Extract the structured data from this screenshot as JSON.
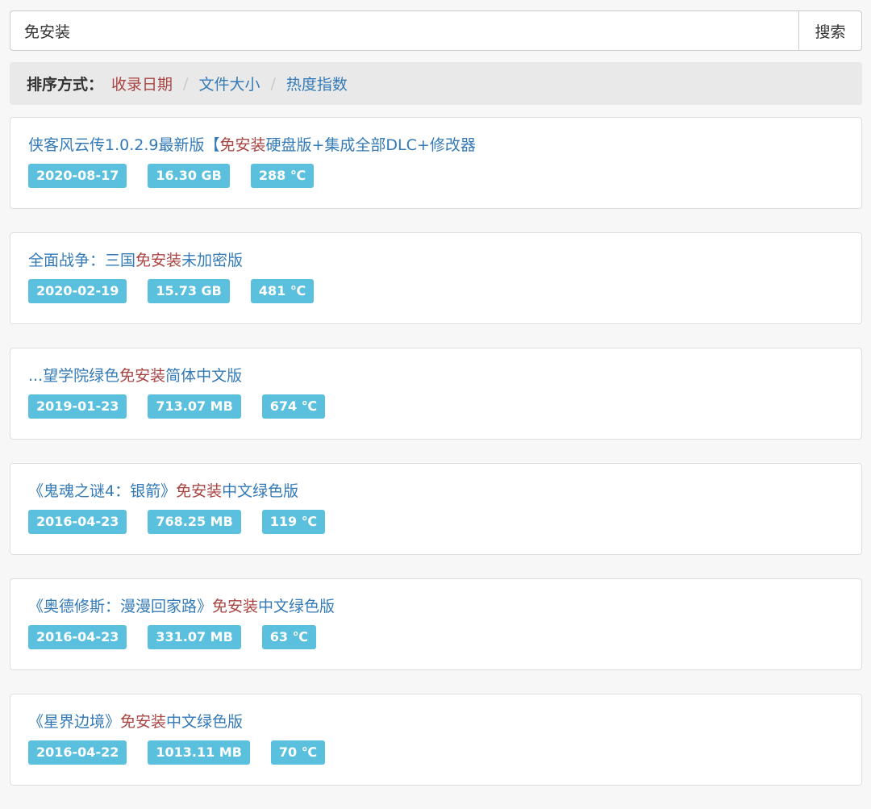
{
  "search": {
    "value": "免安装",
    "button_label": "搜索"
  },
  "sort": {
    "label": "排序方式：",
    "options": [
      "收录日期",
      "文件大小",
      "热度指数"
    ],
    "separator": "/",
    "active": "收录日期"
  },
  "results": [
    {
      "title_pre": "侠客风云传1.0.2.9最新版【",
      "title_hl": "免安装",
      "title_post": "硬盘版+集成全部DLC+修改器",
      "date": "2020-08-17",
      "size": "16.30 GB",
      "heat": "288 ℃"
    },
    {
      "title_pre": "全面战争：三国",
      "title_hl": "免安装",
      "title_post": "未加密版",
      "date": "2020-02-19",
      "size": "15.73 GB",
      "heat": "481 ℃"
    },
    {
      "title_pre": "...望学院绿色",
      "title_hl": "免安装",
      "title_post": "简体中文版",
      "date": "2019-01-23",
      "size": "713.07 MB",
      "heat": "674 ℃"
    },
    {
      "title_pre": "《鬼魂之谜4：银箭》",
      "title_hl": "免安装",
      "title_post": "中文绿色版",
      "date": "2016-04-23",
      "size": "768.25 MB",
      "heat": "119 ℃"
    },
    {
      "title_pre": "《奥德修斯：漫漫回家路》",
      "title_hl": "免安装",
      "title_post": "中文绿色版",
      "date": "2016-04-23",
      "size": "331.07 MB",
      "heat": "63 ℃"
    },
    {
      "title_pre": "《星界边境》",
      "title_hl": "免安装",
      "title_post": "中文绿色版",
      "date": "2016-04-22",
      "size": "1013.11 MB",
      "heat": "70 ℃"
    }
  ],
  "colors": {
    "link": "#337ab7",
    "highlight": "#a94442",
    "tag": "#5bc0de",
    "sortbar": "#e9e9e9"
  }
}
